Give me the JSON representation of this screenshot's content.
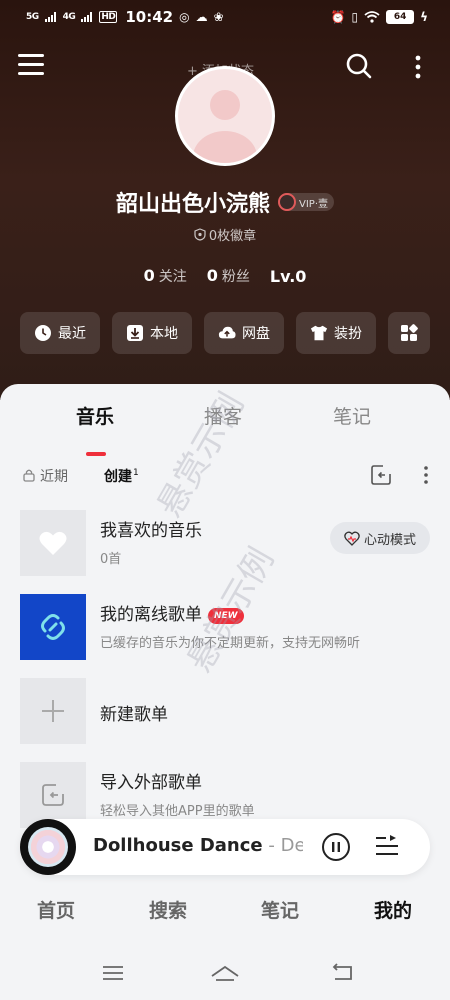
{
  "status_bar": {
    "signal_1": "5G",
    "signal_2": "4G",
    "hd": "HD",
    "time": "10:42",
    "battery": "64"
  },
  "header": {
    "status_hint": "+ 添加状态",
    "nickname": "韶山出色小浣熊",
    "vip_label": "VIP·壹",
    "badges_text": "0枚徽章",
    "following_count": "0",
    "following_label": "关注",
    "followers_count": "0",
    "followers_label": "粉丝",
    "level": "Lv.0"
  },
  "quick_actions": [
    {
      "label": "最近",
      "icon": "clock-icon"
    },
    {
      "label": "本地",
      "icon": "download-box-icon"
    },
    {
      "label": "网盘",
      "icon": "cloud-upload-icon"
    },
    {
      "label": "装扮",
      "icon": "tshirt-icon"
    },
    {
      "label": "",
      "icon": "apps-grid-icon"
    }
  ],
  "tabs": [
    {
      "label": "音乐",
      "active": true
    },
    {
      "label": "播客",
      "active": false
    },
    {
      "label": "笔记",
      "active": false
    }
  ],
  "subbar": {
    "recent": "近期",
    "created": "创建",
    "created_count": "1"
  },
  "playlists": [
    {
      "title": "我喜欢的音乐",
      "subtitle": "0首",
      "action": "心动模式"
    },
    {
      "title": "我的离线歌单",
      "tag": "NEW",
      "subtitle": "已缓存的音乐为你不定期更新，支持无网畅听"
    },
    {
      "title": "新建歌单"
    },
    {
      "title": "导入外部歌单",
      "subtitle": "轻松导入其他APP里的歌单"
    }
  ],
  "watermark": "悬赏示例",
  "player": {
    "title": "Dollhouse Dance",
    "separator": " - ",
    "artist": "Deep"
  },
  "bottom_nav": [
    {
      "label": "首页",
      "active": false
    },
    {
      "label": "搜索",
      "active": false
    },
    {
      "label": "笔记",
      "active": false
    },
    {
      "label": "我的",
      "active": true
    }
  ],
  "colors": {
    "accent": "#ef2f3b",
    "hero_bg": "#2f1d17",
    "offline_cover": "#1246c8"
  }
}
